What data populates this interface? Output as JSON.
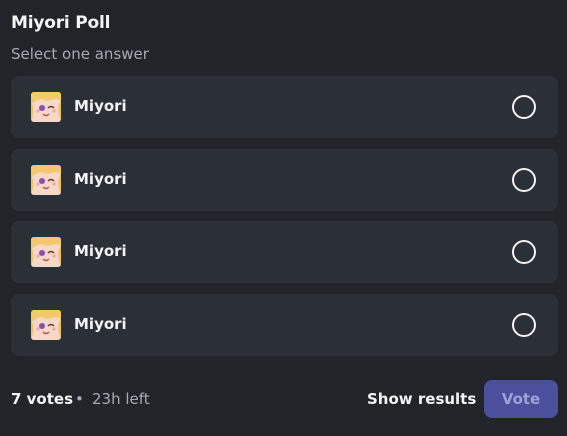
{
  "poll": {
    "title": "Miyori Poll",
    "subtitle": "Select one answer",
    "options": [
      {
        "label": "Miyori",
        "avatar_icon": "miyori-avatar-icon",
        "selected": false
      },
      {
        "label": "Miyori",
        "avatar_icon": "miyori-avatar-icon",
        "selected": false
      },
      {
        "label": "Miyori",
        "avatar_icon": "miyori-avatar-icon",
        "selected": false
      },
      {
        "label": "Miyori",
        "avatar_icon": "miyori-avatar-icon",
        "selected": false
      }
    ]
  },
  "footer": {
    "votes": "7 votes",
    "separator": "•",
    "time_left": "23h left",
    "show_results_label": "Show results",
    "vote_label": "Vote"
  },
  "colors": {
    "background": "#212529",
    "option_background": "#2b2f36",
    "text_primary": "#f2f3f5",
    "text_muted": "#a6abb3",
    "vote_button_disabled": "#4b4f9c"
  }
}
